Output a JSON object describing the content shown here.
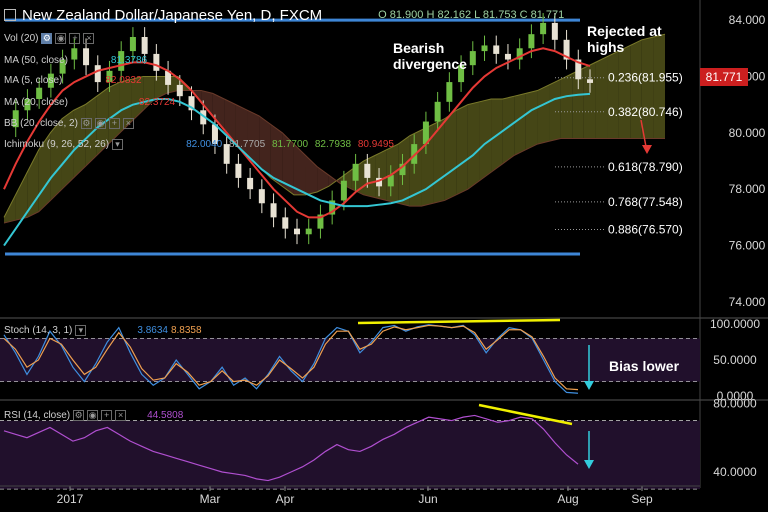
{
  "header": {
    "title": "New Zealand Dollar/Japanese Yen, D, FXCM",
    "ohlc": "O 81.900 H 82.162 L 81.753 C 81.771"
  },
  "indicators": {
    "vol": {
      "label": "Vol (20)"
    },
    "ma50": {
      "label": "MA (50, close)",
      "value": "81.3786"
    },
    "ma5": {
      "label": "MA (5, close)",
      "value": "82.0832"
    },
    "ma20": {
      "label": "MA (20, close)",
      "value": "82.3724"
    },
    "bb": {
      "label": "BB (20, close, 2)"
    },
    "ichimoku": {
      "label": "Ichimoku (9, 26, 52, 26)",
      "values": [
        "82.0040",
        "81.7705",
        "81.7700",
        "82.7938",
        "80.9495"
      ]
    },
    "stoch": {
      "label": "Stoch (14, 3, 1)",
      "k": "3.8634",
      "d": "8.8358"
    },
    "rsi": {
      "label": "RSI (14, close)",
      "value": "44.5808"
    }
  },
  "annotations": {
    "bearish": "Bearish divergence",
    "rejected": "Rejected at highs",
    "bias": "Bias lower"
  },
  "current_price": "81.771",
  "colors": {
    "background": "#000000",
    "up_candle": "#6fbe44",
    "down_candle": "#e8e2d4",
    "ma_red": "#e53935",
    "ma_cyan": "#34c6d3",
    "cloud_bull": "#4d4e18",
    "cloud_bear": "#4a2820",
    "support_line": "#3e86d6",
    "stoch_k": "#3f8fe0",
    "stoch_d": "#f0a050",
    "rsi_line": "#b04fd0",
    "divergence": "#f0f000",
    "arrow_red": "#e53935",
    "arrow_cyan": "#33ccdd",
    "panel_bg": "#21102c"
  },
  "chart_data": [
    {
      "type": "line",
      "title": "New Zealand Dollar/Japanese Yen, D, FXCM",
      "x_ticks": [
        "2017",
        "Mar",
        "Apr",
        "Jun",
        "Aug",
        "Sep"
      ],
      "ylim": [
        73.5,
        84.5
      ],
      "y_ticks": [
        "84.000",
        "82.000",
        "80.000",
        "78.000",
        "76.000",
        "74.000"
      ],
      "series": [
        {
          "name": "Close",
          "values": [
            80.2,
            80.8,
            81.2,
            81.6,
            82.1,
            82.6,
            83.0,
            82.4,
            81.8,
            82.2,
            82.9,
            83.4,
            82.8,
            82.2,
            81.7,
            81.3,
            80.8,
            80.3,
            79.6,
            78.9,
            78.4,
            78.0,
            77.5,
            77.0,
            76.6,
            76.4,
            76.6,
            77.1,
            77.6,
            78.3,
            78.9,
            78.4,
            78.1,
            78.5,
            78.9,
            79.6,
            80.4,
            81.1,
            81.8,
            82.4,
            82.9,
            83.1,
            82.8,
            82.6,
            83.0,
            83.5,
            83.9,
            83.3,
            82.6,
            81.9,
            81.77
          ]
        },
        {
          "name": "MA (20, close)",
          "values": [
            78.0,
            78.9,
            79.7,
            80.4,
            81.0,
            81.5,
            81.8,
            82.0,
            82.2,
            82.3,
            82.4,
            82.5,
            82.5,
            82.4,
            82.2,
            81.9,
            81.5,
            81.0,
            80.5,
            80.0,
            79.5,
            79.0,
            78.5,
            78.0,
            77.6,
            77.2,
            77.0,
            77.0,
            77.2,
            77.5,
            77.9,
            78.2,
            78.3,
            78.5,
            78.8,
            79.2,
            79.6,
            80.1,
            80.6,
            81.1,
            81.6,
            82.0,
            82.3,
            82.5,
            82.7,
            82.9,
            83.0,
            82.9,
            82.7,
            82.5,
            82.37
          ]
        },
        {
          "name": "MA (50, close)",
          "values": [
            76.0,
            76.6,
            77.2,
            77.8,
            78.4,
            78.9,
            79.4,
            79.8,
            80.2,
            80.5,
            80.8,
            81.0,
            81.1,
            81.2,
            81.2,
            81.1,
            80.9,
            80.6,
            80.3,
            79.9,
            79.5,
            79.1,
            78.7,
            78.4,
            78.2,
            78.0,
            77.8,
            77.6,
            77.5,
            77.4,
            77.4,
            77.4,
            77.45,
            77.5,
            77.6,
            77.8,
            78.0,
            78.3,
            78.6,
            78.9,
            79.2,
            79.6,
            79.9,
            80.2,
            80.5,
            80.8,
            81.0,
            81.2,
            81.3,
            81.35,
            81.38
          ]
        }
      ],
      "ichimoku_cloud": {
        "span_a": [
          77.0,
          77.8,
          78.6,
          79.4,
          80.0,
          80.5,
          80.8,
          81.0,
          81.3,
          81.6,
          81.8,
          81.9,
          82.0,
          82.0,
          82.0,
          82.0,
          81.6,
          81.1,
          80.6,
          80.1,
          79.6,
          79.2,
          78.8,
          78.4,
          78.1,
          77.8,
          77.8,
          77.9,
          78.1,
          78.4,
          78.7,
          79.0,
          79.2,
          79.4,
          79.6,
          79.9,
          80.1,
          80.3,
          80.5,
          80.8,
          81.0,
          81.1,
          81.2,
          81.2,
          81.3,
          81.4,
          81.5,
          81.7,
          81.9,
          82.1,
          82.3,
          82.5,
          82.7,
          82.9,
          83.1,
          83.3,
          83.4,
          83.5
        ],
        "span_b": [
          76.8,
          76.9,
          77.0,
          77.2,
          77.6,
          78.0,
          78.4,
          78.8,
          79.2,
          79.6,
          80.0,
          80.4,
          80.8,
          81.2,
          81.4,
          81.5,
          81.5,
          81.5,
          81.4,
          81.2,
          81.0,
          80.8,
          80.6,
          80.3,
          80.0,
          79.6,
          79.2,
          78.8,
          78.5,
          78.2,
          78.0,
          77.8,
          77.7,
          77.6,
          77.5,
          77.4,
          77.4,
          77.5,
          77.6,
          77.8,
          78.0,
          78.3,
          78.6,
          78.9,
          79.2,
          79.4,
          79.6,
          79.7,
          79.8,
          79.8,
          79.8,
          79.8,
          79.8,
          79.8,
          79.8,
          79.8,
          79.8,
          79.8
        ]
      },
      "fibonacci_levels": [
        {
          "label": "0.236(81.955)",
          "value": 81.955
        },
        {
          "label": "0.382(80.746)",
          "value": 80.746
        },
        {
          "label": "0.618(78.790)",
          "value": 78.79
        },
        {
          "label": "0.768(77.548)",
          "value": 77.548
        },
        {
          "label": "0.886(76.570)",
          "value": 76.57
        }
      ],
      "horizontal_lines": [
        84.0,
        75.7
      ]
    },
    {
      "type": "line",
      "title": "Stoch (14, 3, 1)",
      "ylim": [
        0,
        100
      ],
      "y_ticks": [
        "100.0000",
        "50.0000",
        "0.0000"
      ],
      "bands": [
        80,
        20
      ],
      "series": [
        {
          "name": "%K",
          "values": [
            85,
            60,
            30,
            55,
            90,
            70,
            40,
            20,
            45,
            75,
            95,
            60,
            30,
            15,
            25,
            50,
            30,
            10,
            20,
            40,
            15,
            25,
            10,
            30,
            55,
            35,
            20,
            45,
            80,
            95,
            90,
            60,
            75,
            95,
            98,
            90,
            96,
            99,
            97,
            95,
            98,
            85,
            60,
            80,
            95,
            92,
            80,
            50,
            20,
            5,
            3.8634
          ]
        },
        {
          "name": "%D",
          "values": [
            80,
            65,
            40,
            50,
            80,
            72,
            50,
            30,
            40,
            65,
            88,
            68,
            38,
            22,
            25,
            45,
            33,
            15,
            20,
            35,
            20,
            22,
            15,
            28,
            50,
            38,
            25,
            40,
            72,
            90,
            90,
            65,
            72,
            90,
            96,
            92,
            95,
            98,
            97,
            95,
            97,
            88,
            65,
            78,
            92,
            92,
            82,
            55,
            25,
            10,
            8.8358
          ]
        }
      ]
    },
    {
      "type": "line",
      "title": "RSI (14, close)",
      "ylim": [
        33,
        82
      ],
      "y_ticks": [
        "80.0000",
        "40.0000"
      ],
      "bands": [
        70,
        30
      ],
      "series": [
        {
          "name": "RSI",
          "values": [
            64,
            62,
            60,
            63,
            66,
            62,
            58,
            60,
            64,
            66,
            62,
            58,
            55,
            52,
            50,
            48,
            46,
            44,
            42,
            40,
            39,
            38,
            36,
            35,
            37,
            40,
            43,
            47,
            52,
            56,
            53,
            52,
            55,
            59,
            62,
            66,
            69,
            72,
            71,
            70,
            72,
            73,
            71,
            69,
            70,
            72,
            71,
            65,
            57,
            50,
            44.58
          ]
        }
      ]
    }
  ]
}
